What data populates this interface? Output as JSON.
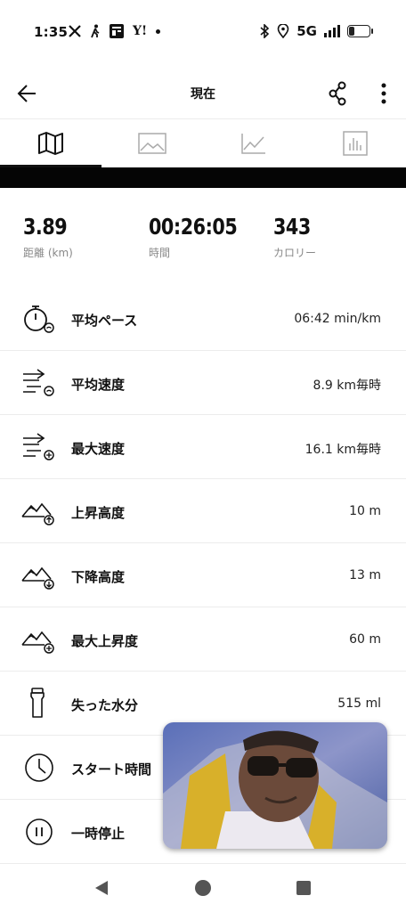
{
  "status_bar": {
    "time": "1:35",
    "notification_icons": [
      "x-icon",
      "person-walk-icon",
      "news-icon",
      "yahoo-icon",
      "dot-icon"
    ],
    "yahoo_text": "Y!",
    "network": "5G",
    "battery_level": 0.3
  },
  "app_bar": {
    "title": "現在"
  },
  "tabs": [
    {
      "icon": "map-icon",
      "active": true
    },
    {
      "icon": "image-icon",
      "active": false
    },
    {
      "icon": "line-chart-icon",
      "active": false
    },
    {
      "icon": "bar-chart-icon",
      "active": false
    }
  ],
  "summary": [
    {
      "value": "3.89",
      "label": "距離 (km)"
    },
    {
      "value": "00:26:05",
      "label": "時間"
    },
    {
      "value": "343",
      "label": "カロリー"
    }
  ],
  "stats": [
    {
      "icon": "stopwatch-icon",
      "label": "平均ペース",
      "value": "06:42 min/km"
    },
    {
      "icon": "avg-speed-icon",
      "label": "平均速度",
      "value": "8.9 km毎時"
    },
    {
      "icon": "max-speed-icon",
      "label": "最大速度",
      "value": "16.1 km毎時"
    },
    {
      "icon": "ascent-icon",
      "label": "上昇高度",
      "value": "10 m"
    },
    {
      "icon": "descent-icon",
      "label": "下降高度",
      "value": "13 m"
    },
    {
      "icon": "max-ascent-icon",
      "label": "最大上昇度",
      "value": "60 m"
    },
    {
      "icon": "water-bottle-icon",
      "label": "失った水分",
      "value": "515 ml"
    },
    {
      "icon": "clock-icon",
      "label": "スタート時間",
      "value": ""
    },
    {
      "icon": "pause-icon",
      "label": "一時停止",
      "value": ""
    }
  ],
  "nav_bar": {
    "buttons": [
      "back-triangle-icon",
      "home-circle-icon",
      "recents-square-icon"
    ]
  }
}
